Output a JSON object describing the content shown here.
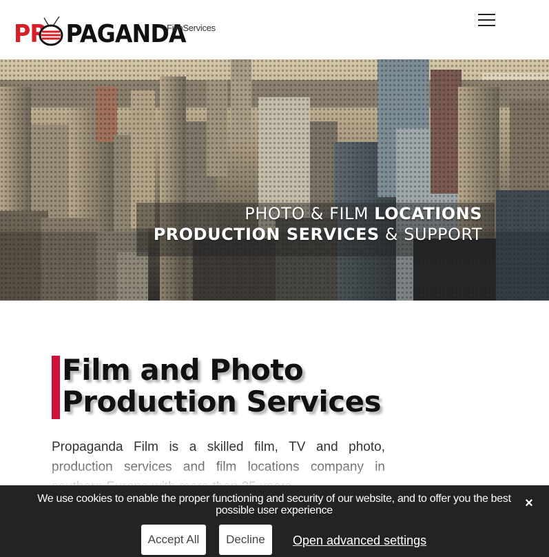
{
  "header": {
    "logo": {
      "text_red": "PR",
      "text_black": "PAGANDA",
      "red": "#d61f26"
    },
    "tagline": "FilmServices",
    "menu_icon": "hamburger-menu-icon"
  },
  "hero": {
    "line1_light": "PHOTO & FILM ",
    "line1_bold": "LOCATIONS",
    "line2_bold": "PRODUCTION SERVICES",
    "line2_light": " & SUPPORT"
  },
  "content": {
    "title": "Film and Photo Production Services",
    "accent_color": "#d0103a",
    "intro": "Propaganda Film is a skilled film, TV and photo, production services and film locations company in southern Europe with more than 25 years"
  },
  "cookie_banner": {
    "message": "We use cookies to enable the proper functioning and security of our website, and to offer you the best possible user experience",
    "accept_label": "Accept All",
    "decline_label": "Decline",
    "settings_label": "Open advanced settings",
    "close_label": "×",
    "background": "#232323"
  }
}
